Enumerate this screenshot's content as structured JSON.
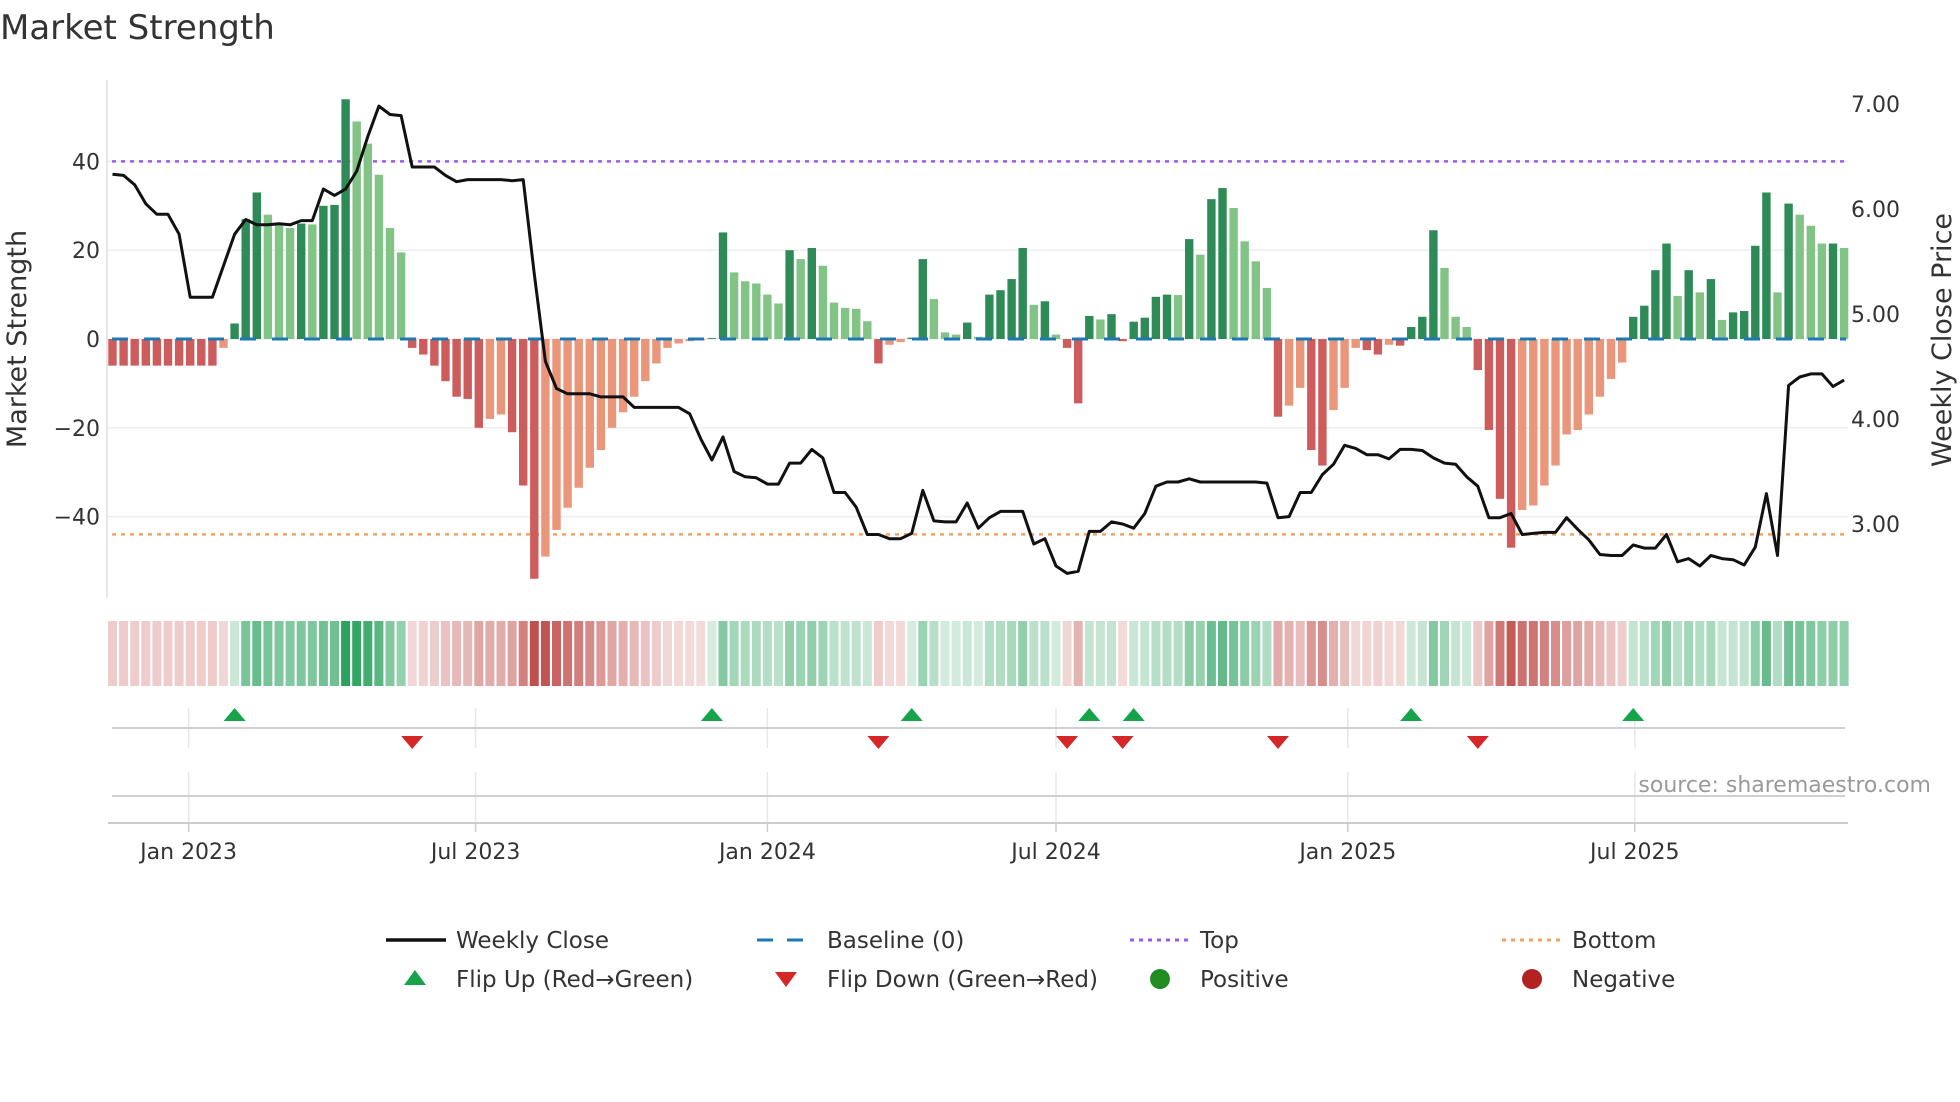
{
  "chart_data": {
    "type": "bar",
    "title": "Market Strength",
    "ylabel": "Market Strength",
    "y2label": "Weekly Close Price",
    "ylim": [
      -57,
      57
    ],
    "y2lim": [
      2.2,
      7.2
    ],
    "yticks": [
      40,
      20,
      0,
      -20,
      -40
    ],
    "ytick_labels": [
      "40",
      "20",
      "0",
      "−20",
      "−40"
    ],
    "y2ticks": [
      7,
      6,
      5,
      4,
      3
    ],
    "y2tick_labels": [
      "7.00",
      "6.00",
      "5.00",
      "4.00",
      "3.00"
    ],
    "xticks": [
      {
        "date": "2023-01-01",
        "label": "Jan 2023"
      },
      {
        "date": "2023-07-01",
        "label": "Jul 2023"
      },
      {
        "date": "2024-01-01",
        "label": "Jan 2024"
      },
      {
        "date": "2024-07-01",
        "label": "Jul 2024"
      },
      {
        "date": "2025-01-01",
        "label": "Jan 2025"
      },
      {
        "date": "2025-07-01",
        "label": "Jul 2025"
      }
    ],
    "x_start": "2022-11-14",
    "x_frequency": "weekly",
    "grid": true,
    "top_level": 40,
    "bottom_level": -44,
    "baseline": 0,
    "strength": [
      -6,
      -6,
      -6,
      -6,
      -6,
      -6,
      -6,
      -6,
      -6,
      -6,
      -2,
      3.5,
      27,
      33,
      28,
      26,
      25,
      26,
      25.8,
      30,
      30.2,
      54,
      49,
      44,
      37,
      25,
      19.5,
      -2,
      -3.5,
      -6,
      -9.5,
      -13,
      -13.5,
      -20,
      -18,
      -17,
      -21,
      -33,
      -54,
      -49,
      -43,
      -38,
      -33.5,
      -29,
      -25,
      -20,
      -16.5,
      -13,
      -9.5,
      -5.5,
      -2,
      -1,
      -0.5,
      -0.3,
      0.2,
      24,
      15,
      13,
      12.5,
      10,
      8,
      20,
      18,
      20.5,
      16.5,
      8.2,
      7,
      6.8,
      4,
      -5.5,
      -1.3,
      -0.7,
      0.3,
      18,
      9,
      1.5,
      1,
      3.7,
      0.5,
      10,
      11,
      13.5,
      20.5,
      7.7,
      8.5,
      1,
      -2,
      -14.5,
      5.2,
      4.4,
      5.6,
      -0.5,
      3.9,
      4.8,
      9.5,
      10,
      9.9,
      22.5,
      19,
      31.5,
      34,
      29.5,
      22,
      17.5,
      11.5,
      -17.5,
      -15,
      -11,
      -25,
      -28.5,
      -16,
      -11,
      -2,
      -2.5,
      -3.5,
      -1.3,
      -1.5,
      2.7,
      5,
      24.5,
      16,
      5,
      2.7,
      -7,
      -20.5,
      -36,
      -47,
      -38.5,
      -37.5,
      -33,
      -28.5,
      -21.5,
      -20.5,
      -17,
      -13,
      -9,
      -5.3,
      5,
      7.5,
      15.5,
      21.5,
      9.7,
      15.5,
      10.5,
      13.5,
      4.3,
      6,
      6.3,
      21,
      33,
      10.5,
      30.5,
      28,
      25.5,
      21.5,
      21.5,
      20.5
    ],
    "weekly_close": [
      6.33,
      6.32,
      6.23,
      6.05,
      5.95,
      5.95,
      5.76,
      5.16,
      5.16,
      5.16,
      5.46,
      5.76,
      5.9,
      5.85,
      5.85,
      5.86,
      5.85,
      5.89,
      5.89,
      6.19,
      6.13,
      6.19,
      6.36,
      6.69,
      6.98,
      6.9,
      6.89,
      6.4,
      6.4,
      6.4,
      6.32,
      6.26,
      6.28,
      6.28,
      6.28,
      6.28,
      6.27,
      6.28,
      5.38,
      4.55,
      4.29,
      4.24,
      4.24,
      4.24,
      4.21,
      4.21,
      4.21,
      4.11,
      4.11,
      4.11,
      4.11,
      4.11,
      4.05,
      3.81,
      3.61,
      3.83,
      3.5,
      3.45,
      3.44,
      3.38,
      3.38,
      3.58,
      3.58,
      3.71,
      3.63,
      3.3,
      3.3,
      3.16,
      2.9,
      2.9,
      2.86,
      2.86,
      2.91,
      3.32,
      3.03,
      3.02,
      3.02,
      3.2,
      2.96,
      3.06,
      3.12,
      3.12,
      3.12,
      2.81,
      2.86,
      2.6,
      2.53,
      2.55,
      2.93,
      2.93,
      3.02,
      3.0,
      2.96,
      3.1,
      3.36,
      3.4,
      3.4,
      3.43,
      3.4,
      3.4,
      3.4,
      3.4,
      3.4,
      3.4,
      3.39,
      3.06,
      3.07,
      3.3,
      3.3,
      3.47,
      3.57,
      3.75,
      3.72,
      3.66,
      3.66,
      3.62,
      3.71,
      3.71,
      3.7,
      3.63,
      3.58,
      3.57,
      3.45,
      3.36,
      3.06,
      3.06,
      3.1,
      2.9,
      2.91,
      2.92,
      2.92,
      3.06,
      2.95,
      2.85,
      2.71,
      2.7,
      2.7,
      2.8,
      2.77,
      2.77,
      2.9,
      2.64,
      2.67,
      2.6,
      2.7,
      2.67,
      2.66,
      2.61,
      2.78,
      3.29,
      2.7,
      4.32,
      4.4,
      4.43,
      4.43,
      4.31,
      4.37
    ],
    "colors": {
      "rising_positive": "#2e8b57",
      "falling_positive": "#82c485",
      "falling_negative": "#cd5c5c",
      "rising_negative": "#e9967a",
      "strip_positive": "#2ca25f",
      "strip_negative": "#c0504d",
      "line": "#111111",
      "baseline": "#1f77b4",
      "top": "#9b5de5",
      "bottom": "#f4a261",
      "flip_up": "#16a34a",
      "flip_down": "#d62728",
      "positive": "#228b22",
      "negative": "#b22222"
    },
    "legend": [
      {
        "label": "Weekly Close",
        "marker": "line"
      },
      {
        "label": "Baseline (0)",
        "marker": "dash"
      },
      {
        "label": "Top",
        "marker": "dot-line"
      },
      {
        "label": "Bottom",
        "marker": "dot-line"
      },
      {
        "label": "Flip Up (Red→Green)",
        "marker": "triangle-up"
      },
      {
        "label": "Flip Down (Green→Red)",
        "marker": "triangle-down"
      },
      {
        "label": "Positive",
        "marker": "circle"
      },
      {
        "label": "Negative",
        "marker": "circle"
      }
    ],
    "legend_position": "bottom",
    "source": "source: sharemaestro.com"
  }
}
